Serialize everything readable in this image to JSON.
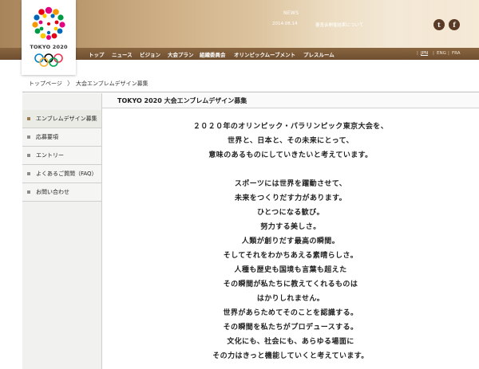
{
  "header": {
    "logo_text": "TOKYO 2020",
    "news_label": "NEWS",
    "news_date": "2014.08.14",
    "news_text": "審査会開催結果について",
    "social": [
      {
        "name": "twitter-icon",
        "glyph": "t"
      },
      {
        "name": "facebook-icon",
        "glyph": "f"
      }
    ]
  },
  "nav": {
    "items": [
      "トップ",
      "ニュース",
      "ビジョン",
      "大会プラン",
      "組織委員会",
      "オリンピックムーブメント",
      "プレスルーム"
    ],
    "languages": [
      "JPN",
      "ENG",
      "FRA"
    ],
    "active_language": "JPN"
  },
  "breadcrumb": {
    "home": "トップページ",
    "separator": "〉",
    "current": "大会エンブレムデザイン募集"
  },
  "sidebar": {
    "items": [
      {
        "label": "エンブレムデザイン募集",
        "active": true
      },
      {
        "label": "応募要項",
        "active": false
      },
      {
        "label": "エントリー",
        "active": false
      },
      {
        "label": "よくあるご質問（FAQ）",
        "active": false
      },
      {
        "label": "お問い合わせ",
        "active": false
      }
    ]
  },
  "main": {
    "title": "TOKYO 2020 大会エンブレムデザイン募集",
    "paragraph1": [
      "２０２０年のオリンピック・パラリンピック東京大会を、",
      "世界と、日本と、その未来にとって、",
      "意味のあるものにしていきたいと考えています。"
    ],
    "paragraph2": [
      "スポーツには世界を躍動させて、",
      "未来をつくりだす力があります。",
      "ひとつになる歓び。",
      "努力する美しさ。",
      "人類が創りだす最高の瞬間。",
      "そしてそれをわかちあえる素晴らしさ。",
      "人種も歴史も国境も言葉も超えた",
      "その瞬間が私たちに教えてくれるものは",
      "はかりしれません。",
      "世界があらためてそのことを認識する。",
      "その瞬間を私たちがプロデュースする。",
      "文化にも、社会にも、あらゆる場面に",
      "その力はきっと機能していくと考えています。"
    ]
  },
  "colors": {
    "header_gold": "#cfb086",
    "nav_brown": "#6d4e30",
    "accent": "#9a7a4f"
  }
}
